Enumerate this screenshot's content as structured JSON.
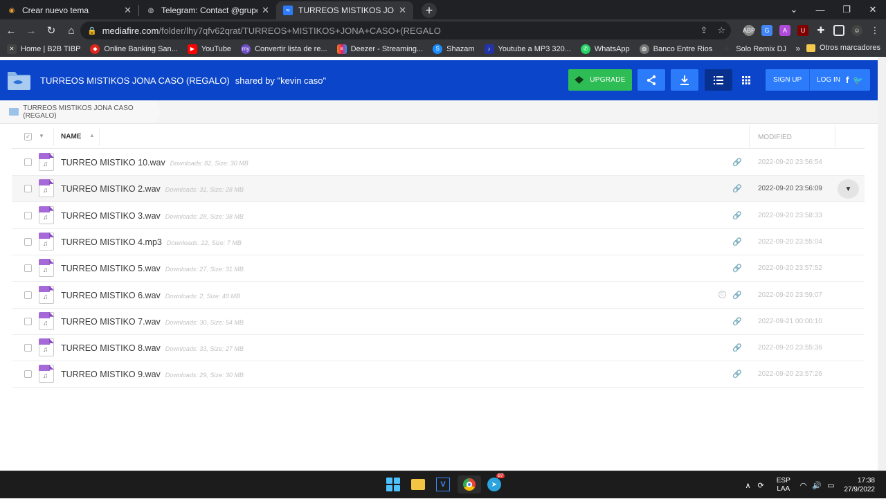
{
  "browser": {
    "tabs": [
      {
        "title": "Crear nuevo tema",
        "icon": "forum-icon"
      },
      {
        "title": "Telegram: Contact @grupodedjs",
        "icon": "globe-icon"
      },
      {
        "title": "TURREOS MISTIKOS JONA CASO",
        "icon": "mediafire-icon",
        "active": true
      }
    ],
    "url_domain": "mediafire.com",
    "url_path": "/folder/lhy7qfv62qrat/TURREOS+MISTIKOS+JONA+CASO+(REGALO",
    "bookmarks": [
      {
        "label": "Home | B2B TIBP",
        "color": "#444444"
      },
      {
        "label": "Online Banking San...",
        "color": "#e0261a"
      },
      {
        "label": "YouTube",
        "color": "#ff0000"
      },
      {
        "label": "Convertir lista de re...",
        "color": "#6c4dc4"
      },
      {
        "label": "Deezer - Streaming...",
        "color": "#ef7f1a"
      },
      {
        "label": "Shazam",
        "color": "#1a8cff"
      },
      {
        "label": "Youtube a MP3 320...",
        "color": "#2234a8"
      },
      {
        "label": "WhatsApp",
        "color": "#25d366"
      },
      {
        "label": "Banco Entre Rios",
        "color": "#777777"
      },
      {
        "label": "Solo Remix DJ",
        "color": "#35363a"
      }
    ],
    "bookmarks_more": "»",
    "other_bookmarks": "Otros marcadores"
  },
  "header": {
    "folder_name": "TURREOS MISTIKOS JONA CASO (REGALO)",
    "shared_by": "shared by \"kevin caso\"",
    "upgrade_label": "UPGRADE",
    "signup_label": "SIGN UP",
    "login_label": "LOG IN"
  },
  "breadcrumb": "TURREOS MISTIKOS JONA CASO (REGALO)",
  "table": {
    "col_name": "NAME",
    "col_modified": "MODIFIED",
    "rows": [
      {
        "name": "TURREO MISTIKO 10.wav",
        "meta": "Downloads: 82, Size: 30 MB",
        "date": "2022-09-20 23:56:54"
      },
      {
        "name": "TURREO MISTIKO 2.wav",
        "meta": "Downloads: 31, Size: 28 MB",
        "date": "2022-09-20 23:56:09",
        "highlight": true
      },
      {
        "name": "TURREO MISTIKO 3.wav",
        "meta": "Downloads: 28, Size: 38 MB",
        "date": "2022-09-20 23:58:33"
      },
      {
        "name": "TURREO MISTIKO 4.mp3",
        "meta": "Downloads: 22, Size: 7 MB",
        "date": "2022-09-20 23:55:04"
      },
      {
        "name": "TURREO MISTIKO 5.wav",
        "meta": "Downloads: 27, Size: 31 MB",
        "date": "2022-09-20 23:57:52"
      },
      {
        "name": "TURREO MISTIKO 6.wav",
        "meta": "Downloads: 2, Size: 40 MB",
        "date": "2022-09-20 23:59:07",
        "copy": true
      },
      {
        "name": "TURREO MISTIKO 7.wav",
        "meta": "Downloads: 30, Size: 54 MB",
        "date": "2022-09-21 00:00:10"
      },
      {
        "name": "TURREO MISTIKO 8.wav",
        "meta": "Downloads: 33, Size: 27 MB",
        "date": "2022-09-20 23:55:36"
      },
      {
        "name": "TURREO MISTIKO 9.wav",
        "meta": "Downloads: 29, Size: 30 MB",
        "date": "2022-09-20 23:57:26"
      }
    ]
  },
  "taskbar": {
    "telegram_badge": "87",
    "lang_top": "ESP",
    "lang_bottom": "LAA",
    "time": "17:38",
    "date": "27/9/2022"
  }
}
